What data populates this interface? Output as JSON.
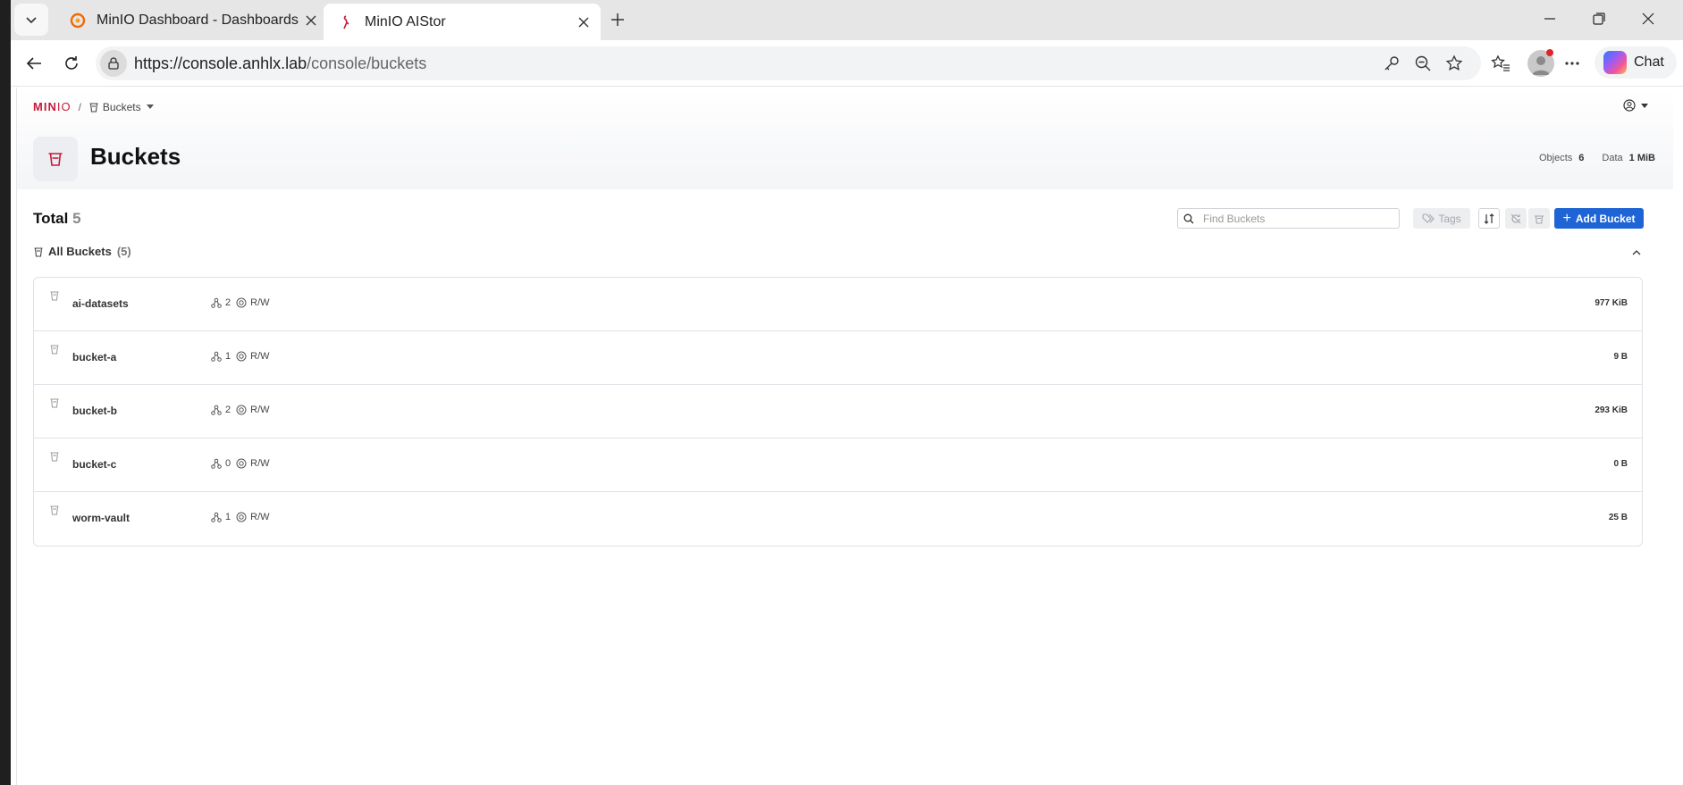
{
  "browser": {
    "tabs": [
      {
        "title": "MinIO Dashboard - Dashboards - G",
        "active": false,
        "icon": "grafana-icon"
      },
      {
        "title": "MinIO AIStor",
        "active": true,
        "icon": "minio-flamingo-icon"
      }
    ],
    "url": {
      "host": "https://console.anhlx.lab",
      "path": "/console/buckets"
    },
    "chat_label": "Chat"
  },
  "app": {
    "logo": {
      "main": "MIN",
      "suffix": "IO"
    },
    "breadcrumb": {
      "separator": "/",
      "current": "Buckets"
    },
    "page_title": "Buckets",
    "stats": {
      "objects_label": "Objects",
      "objects_value": "6",
      "data_label": "Data",
      "data_value": "1 MiB"
    },
    "total_label": "Total",
    "total_count": "5",
    "search_placeholder": "Find Buckets",
    "tags_label": "Tags",
    "add_bucket_label": "Add Bucket",
    "group": {
      "label": "All Buckets",
      "count": "(5)"
    },
    "access_label": "R/W",
    "buckets": [
      {
        "name": "ai-datasets",
        "replicas": "2",
        "access": "R/W",
        "size": "977 KiB"
      },
      {
        "name": "bucket-a",
        "replicas": "1",
        "access": "R/W",
        "size": "9 B"
      },
      {
        "name": "bucket-b",
        "replicas": "2",
        "access": "R/W",
        "size": "293 KiB"
      },
      {
        "name": "bucket-c",
        "replicas": "0",
        "access": "R/W",
        "size": "0 B"
      },
      {
        "name": "worm-vault",
        "replicas": "1",
        "access": "R/W",
        "size": "25 B"
      }
    ]
  },
  "colors": {
    "brand": "#c51b3a",
    "primary": "#1e64d4"
  }
}
